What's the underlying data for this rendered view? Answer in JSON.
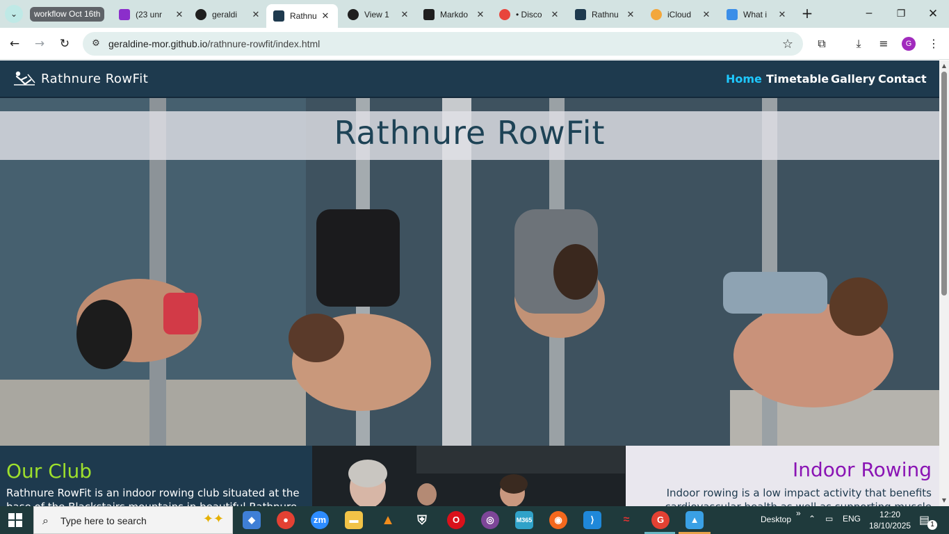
{
  "browser": {
    "tab_group_label": "workflow Oct 16th",
    "tabs": [
      {
        "title": "(23 unr",
        "icon": "mail-icon",
        "color": "#8b2ecb"
      },
      {
        "title": "geraldi",
        "icon": "github-icon",
        "color": "#1f1f1f"
      },
      {
        "title": "Rathnu",
        "icon": "rower-icon",
        "color": "#1e3a4e"
      },
      {
        "title": "View 1",
        "icon": "github-icon",
        "color": "#1f1f1f"
      },
      {
        "title": "Markdo",
        "icon": "markdown-icon",
        "color": "#1f1f1f"
      },
      {
        "title": "• Disco",
        "icon": "discord-icon",
        "color": "#e8453c"
      },
      {
        "title": "Rathnu",
        "icon": "rower-icon",
        "color": "#1e3a4e"
      },
      {
        "title": "iCloud",
        "icon": "photos-icon",
        "color": "#f3a73b"
      },
      {
        "title": "What i",
        "icon": "copilot-icon",
        "color": "#3b8ee8"
      }
    ],
    "url_host": "geraldine-mor.github.io",
    "url_path": "/rathnure-rowfit/index.html",
    "profile_initial": "G"
  },
  "site": {
    "brand": "Rathnure RowFit",
    "nav": [
      {
        "label": "Home",
        "active": true
      },
      {
        "label": "Timetable",
        "active": false
      },
      {
        "label": "Gallery",
        "active": false
      },
      {
        "label": "Contact",
        "active": false
      }
    ],
    "hero_title": "Rathnure RowFit",
    "club": {
      "heading": "Our Club",
      "text": "Rathnure RowFit is an indoor rowing club situated at the base of the Blackstairs mountains in beautiful Rathnure"
    },
    "rowing": {
      "heading": "Indoor Rowing",
      "text": "Indoor rowing is a low impact activity that benefits cardiovascular health as well as supporting muscle"
    },
    "colors": {
      "nav_bg": "#1e3a4e",
      "nav_active": "#1ec8ff",
      "club_heading": "#9ee02c",
      "rowing_heading": "#8a14b4"
    }
  },
  "taskbar": {
    "search_placeholder": "Type here to search",
    "apps": [
      "copilot",
      "chrome",
      "zoom",
      "file-explorer",
      "vlc",
      "security",
      "opera",
      "tor",
      "m365",
      "firefox",
      "vscode",
      "unknown-red",
      "chrome-profile",
      "photos"
    ],
    "desktop_label": "Desktop",
    "language": "ENG",
    "time": "12:20",
    "date": "18/10/2025",
    "notification_count": "1"
  }
}
